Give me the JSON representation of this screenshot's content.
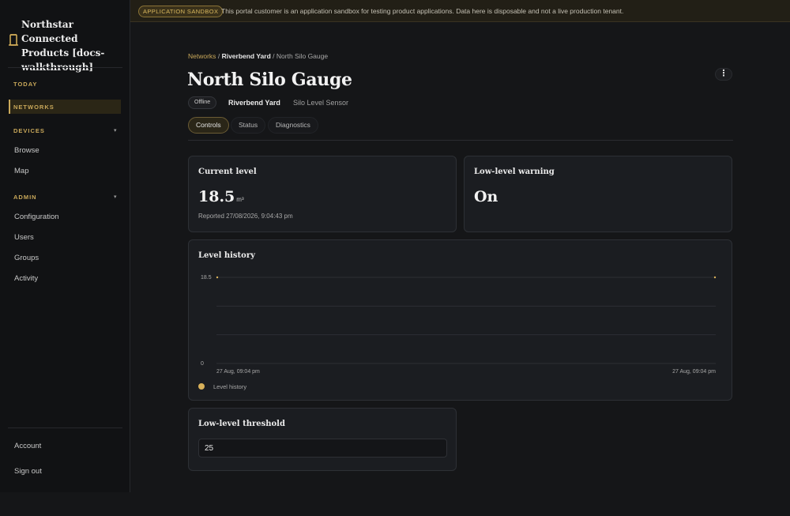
{
  "app": {
    "name": "Northstar Connected Products [docs-walkthrough]"
  },
  "banner": {
    "badge": "APPLICATION SANDBOX",
    "text": "This portal customer is an application sandbox for testing product applications. Data here is disposable and not a live production tenant."
  },
  "sidebar": {
    "today": "TODAY",
    "networks": "NETWORKS",
    "devices": {
      "label": "DEVICES",
      "caret": "▾",
      "items": [
        "Browse",
        "Map"
      ]
    },
    "admin": {
      "label": "ADMIN",
      "caret": "▾",
      "items": [
        "Configuration",
        "Users",
        "Groups",
        "Activity"
      ]
    },
    "account": "Account",
    "signout": "Sign out"
  },
  "breadcrumb": {
    "root": "Networks",
    "sep1": "/",
    "yard": "Riverbend Yard",
    "sep2": "/",
    "current": "North Silo Gauge"
  },
  "device": {
    "title": "North Silo Gauge",
    "status": "Offline",
    "yard": "Riverbend Yard",
    "type": "Silo Level Sensor",
    "menu": "⋮"
  },
  "tabs": [
    "Controls",
    "Status",
    "Diagnostics"
  ],
  "current_level": {
    "title": "Current level",
    "value": "18.5",
    "unit": "m³",
    "reported": "Reported 27/08/2026, 9:04:43 pm"
  },
  "low_warning": {
    "title": "Low-level warning",
    "value": "On"
  },
  "history": {
    "title": "Level history",
    "legend": "Level history"
  },
  "chart_data": {
    "type": "line",
    "title": "Level history",
    "x": [
      "27 Aug, 09:04 pm",
      "27 Aug, 09:04 pm"
    ],
    "series": [
      {
        "name": "Level history",
        "values": [
          18.5,
          18.5
        ]
      }
    ],
    "yticks": [
      "18.5",
      "0"
    ],
    "ylim": [
      0,
      18.5
    ],
    "grid": true,
    "legend": "bottom-left",
    "color": "#d8b15a"
  },
  "threshold": {
    "title": "Low-level threshold",
    "value": "25"
  },
  "colors": {
    "accent": "#c9a85a",
    "background": "#151618",
    "card": "#1b1d21"
  }
}
